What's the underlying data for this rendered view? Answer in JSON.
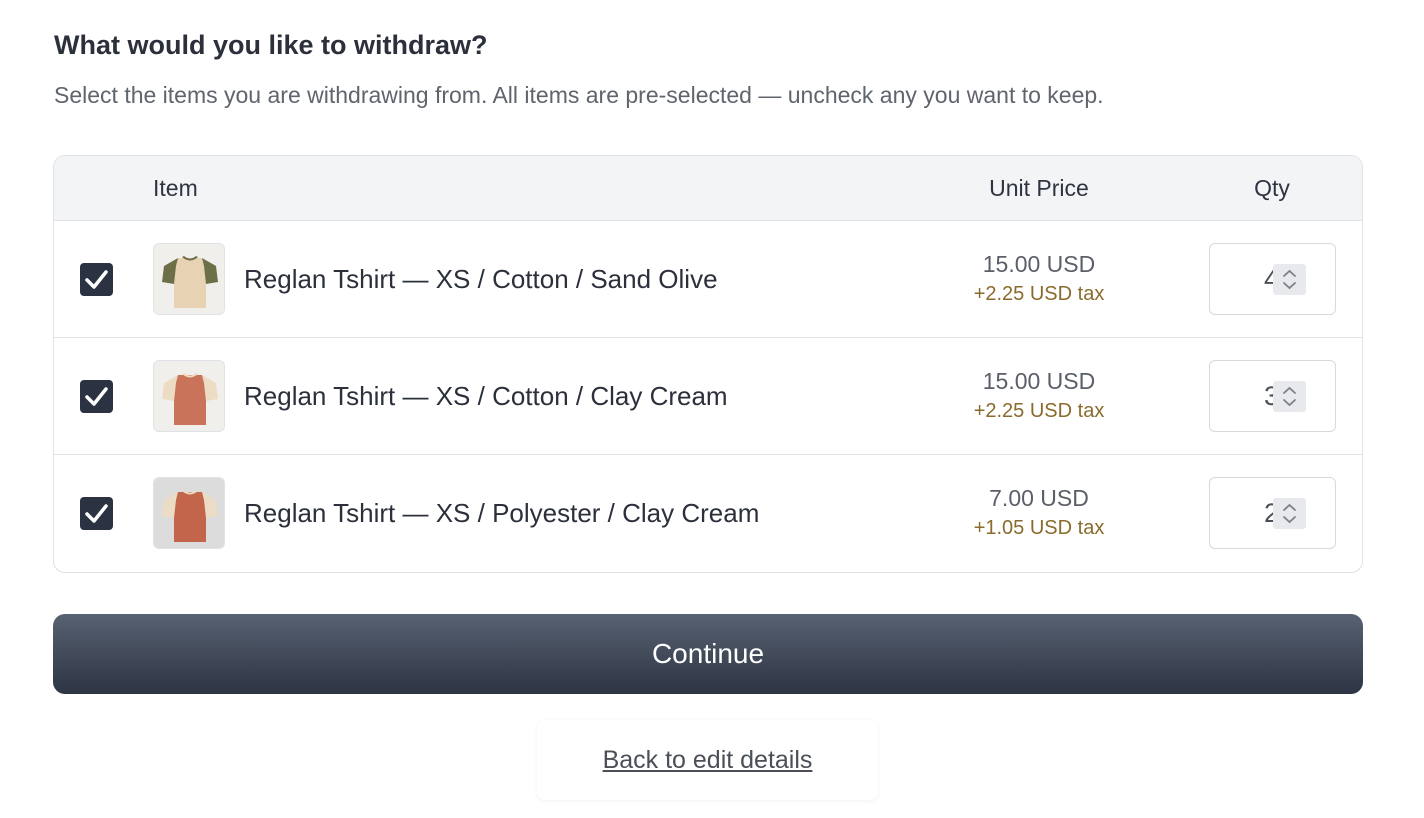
{
  "header": {
    "title": "What would you like to withdraw?",
    "subtitle": "Select the items you are withdrawing from. All items are pre-selected — uncheck any you want to keep."
  },
  "table": {
    "columns": {
      "item": "Item",
      "unit_price": "Unit Price",
      "qty": "Qty"
    },
    "rows": [
      {
        "checked": true,
        "name": "Reglan Tshirt — XS / Cotton / Sand Olive",
        "price": "15.00 USD",
        "tax": "+2.25 USD tax",
        "qty": "4",
        "thumb": {
          "body_color": "#e7d3b3",
          "sleeve_color": "#6d6f47"
        }
      },
      {
        "checked": true,
        "name": "Reglan Tshirt — XS / Cotton / Clay Cream",
        "price": "15.00 USD",
        "tax": "+2.25 USD tax",
        "qty": "3",
        "thumb": {
          "body_color": "#c9735a",
          "sleeve_color": "#eddcc4"
        }
      },
      {
        "checked": true,
        "name": "Reglan Tshirt — XS / Polyester / Clay Cream",
        "price": "7.00 USD",
        "tax": "+1.05 USD tax",
        "qty": "2",
        "thumb": {
          "body_color": "#c2654b",
          "sleeve_color": "#ecdcc6"
        }
      }
    ]
  },
  "actions": {
    "continue_label": "Continue",
    "back_label": "Back to edit details"
  },
  "colors": {
    "primary_button": "#2d3544",
    "checkbox": "#2b3342",
    "tax_text": "#8a6b2c"
  }
}
